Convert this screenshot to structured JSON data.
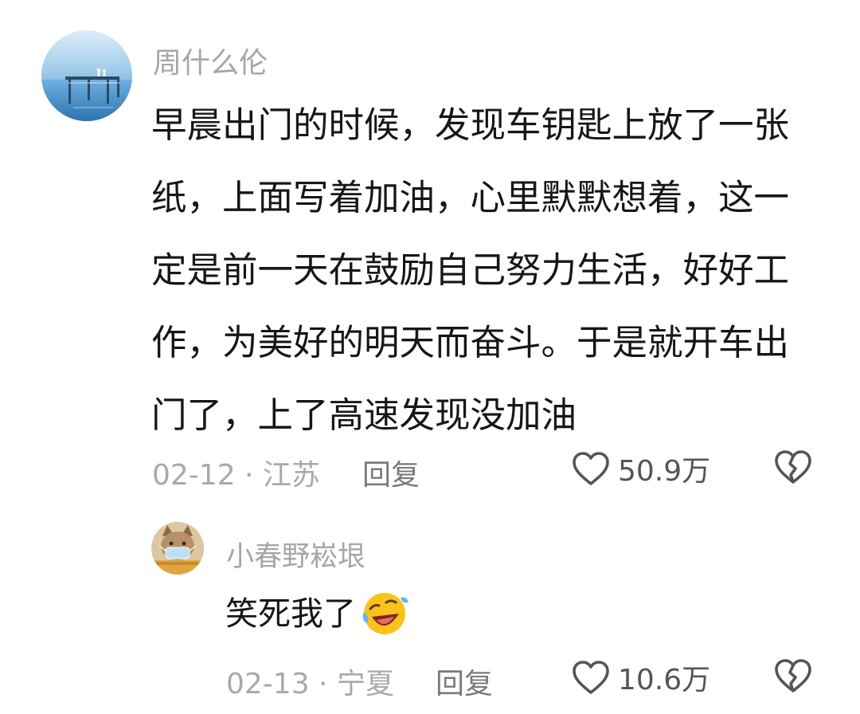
{
  "comment": {
    "username": "周什么伦",
    "text": "早晨出门的时候，发现车钥匙上放了一张纸，上面写着加油，心里默默想着，这一定是前一天在鼓励自己努力生活，好好工作，为美好的明天而奋斗。于是就开车出门了，上了高速发现没加油",
    "date_location": "02-12 · 江苏",
    "reply_label": "回复",
    "likes": "50.9万",
    "like_icon": "heart-outline-icon",
    "dislike_icon": "broken-heart-icon"
  },
  "reply": {
    "username": "小春野崧垠",
    "text": "笑死我了",
    "emoji": "rolling-laughing-emoji",
    "date_location": "02-13 · 宁夏",
    "reply_label": "回复",
    "likes": "10.6万"
  },
  "colors": {
    "text": "#161616",
    "secondary": "#a6a6a6",
    "icon": "#555555"
  }
}
